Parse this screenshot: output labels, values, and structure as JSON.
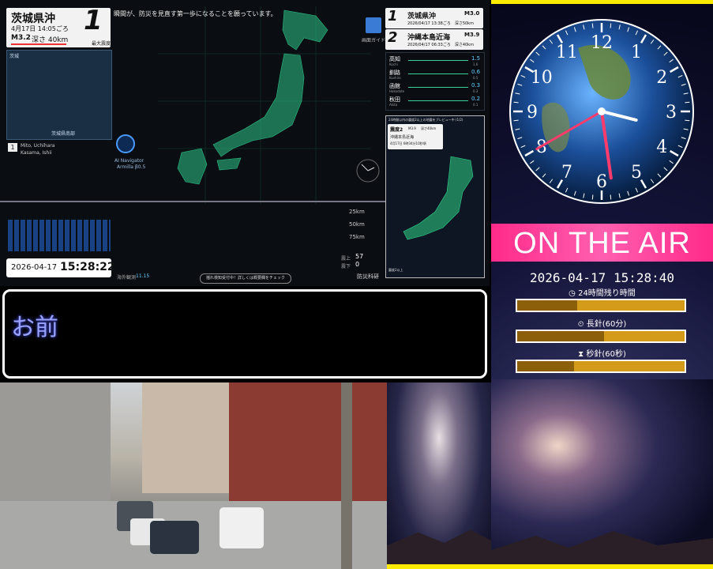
{
  "quake_panel": {
    "region": "茨城県沖",
    "time": "4月17日 14:05ごろ",
    "magnitude": "M3.2",
    "depth": "深さ 40km",
    "intensity": "1",
    "intensity_caption": "最大震度",
    "inset_label_top": "茨城",
    "inset_label_bottom": "茨城県南部",
    "station_rank": "1",
    "station_line1": "Mito, Uchihara",
    "station_line2": "Kasama, Ishii",
    "banner_text": "瞬間が、防災を見直す第一歩になることを願っています。",
    "clock_date": "2026-04-17",
    "clock_time": "15:28:22",
    "ai_label": "AI Navigator",
    "ai_sub": "Armilla β0.5",
    "guide_label": "画面ガイド",
    "footer_button": "揺れ検知受付中！詳しくは概要欄をチェック",
    "credit": "防災科研",
    "depth_ticks": [
      "25km",
      "50km",
      "75km"
    ],
    "stat_left": "海外観測",
    "stat_left_value": "11.15",
    "stat_right1": "震上",
    "stat_right1_value": "57",
    "stat_right2": "震下",
    "stat_right2_value": "0"
  },
  "recent_quakes": [
    {
      "rank": "1",
      "region": "茨城県沖",
      "mag": "M3.0",
      "detail": "2026/04/17 13:38ごろ　深さ50km"
    },
    {
      "rank": "2",
      "region": "沖縄本島近海",
      "mag": "M3.9",
      "detail": "2026/04/17 06:33ごろ　深さ40km"
    }
  ],
  "stations": [
    {
      "name": "高知",
      "romaji": "Kochi",
      "value": "1.5",
      "sub": "1.6"
    },
    {
      "name": "釧路",
      "romaji": "Kushiro",
      "value": "0.6",
      "sub": "0.5"
    },
    {
      "name": "函館",
      "romaji": "Hakodate",
      "value": "0.3",
      "sub": "0.3"
    },
    {
      "name": "秋田",
      "romaji": "Akita",
      "value": "0.2",
      "sub": "0.1"
    }
  ],
  "preview": {
    "title": "24時間以内の震度2以上の地震をプレビュー中 (1/2)",
    "intensity_label": "震度2",
    "mag": "M3.9",
    "depth": "深さ40km",
    "region": "沖縄本島近海",
    "time": "4月17日 6時34分10秒頃",
    "footer": "震度2以上"
  },
  "chat": {
    "text": "お前"
  },
  "clock": {
    "numbers": [
      "12",
      "1",
      "2",
      "3",
      "4",
      "5",
      "6",
      "7",
      "8",
      "9",
      "10",
      "11"
    ],
    "hour": 3,
    "minute": 28,
    "second": 40
  },
  "air": {
    "title": "ON THE AIR",
    "datetime": "2026-04-17 15:28:40",
    "bars": [
      {
        "label": "24時間残り時間",
        "icon": "clock-icon",
        "progress": 0.36
      },
      {
        "label": "長針(60分)",
        "icon": "timer-icon",
        "progress": 0.52
      },
      {
        "label": "秒針(60秒)",
        "icon": "hourglass-icon",
        "progress": 0.34
      }
    ]
  },
  "colors": {
    "accent_pink": "#ff2a8a",
    "bar_gold": "#d49a1a",
    "border_yellow": "#ffeb00",
    "quake_green": "#3ad19a"
  }
}
